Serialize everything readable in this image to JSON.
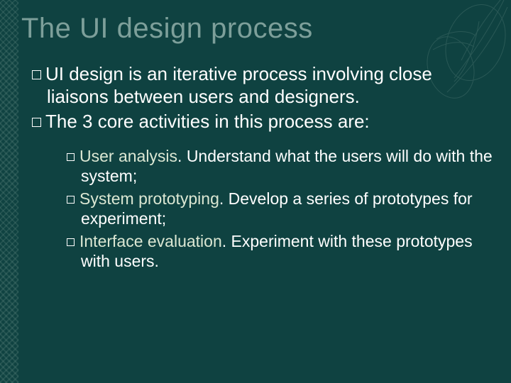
{
  "title": "The UI design process",
  "bullets": {
    "b1": "UI design is an iterative process involving close liaisons between users and designers.",
    "b2": "The 3 core activities in this process are:"
  },
  "sub": {
    "s1_term": "User analysis",
    "s1_rest": ". Understand what the users will do with the system;",
    "s2_term": "System prototyping",
    "s2_rest": ". Develop a series of prototypes for experiment;",
    "s3_term": "Interface evaluation",
    "s3_rest": ". Experiment with these prototypes with users."
  }
}
